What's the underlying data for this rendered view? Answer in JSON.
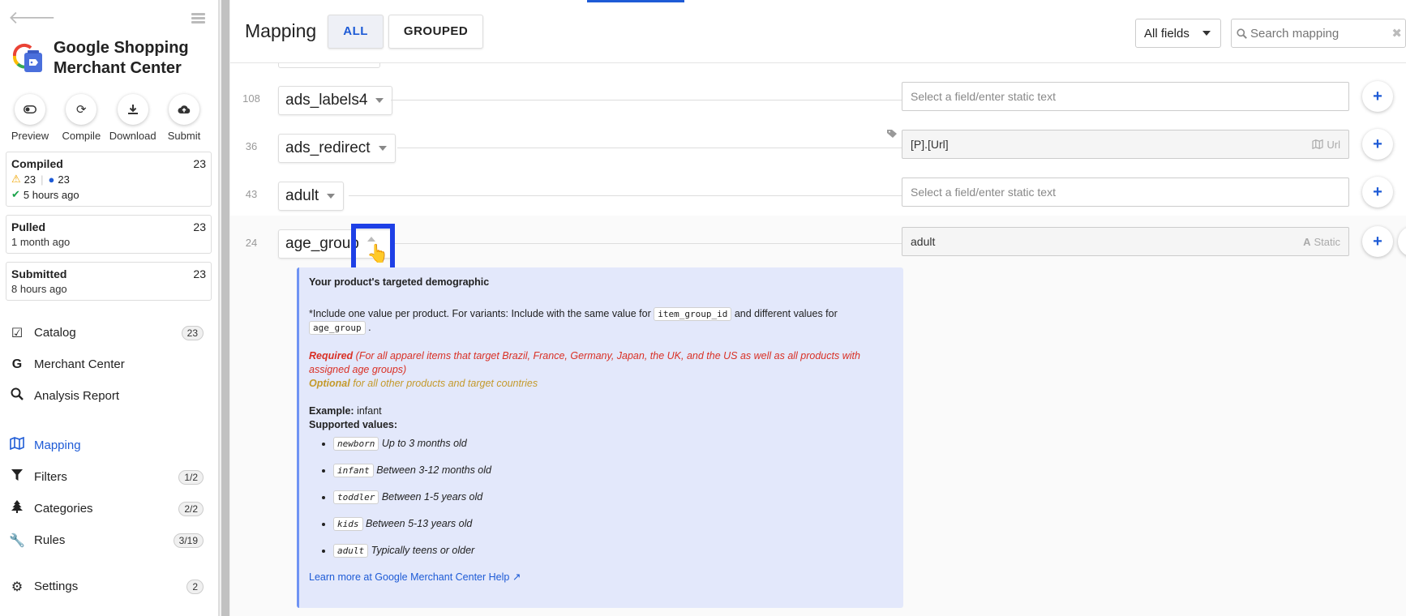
{
  "sidebar": {
    "brand_line1": "Google Shopping",
    "brand_line2": "Merchant Center",
    "actions": [
      {
        "label": "Preview",
        "icon": "toggle-icon"
      },
      {
        "label": "Compile",
        "icon": "refresh-icon"
      },
      {
        "label": "Download",
        "icon": "download-icon"
      },
      {
        "label": "Submit",
        "icon": "cloud-upload-icon"
      }
    ],
    "compiled": {
      "title": "Compiled",
      "count": "23",
      "warnings": "23",
      "infos": "23",
      "time": "5 hours ago"
    },
    "pulled": {
      "title": "Pulled",
      "count": "23",
      "time": "1 month ago"
    },
    "submitted": {
      "title": "Submitted",
      "count": "23",
      "time": "8 hours ago"
    },
    "nav": [
      {
        "label": "Catalog",
        "badge": "23"
      },
      {
        "label": "Merchant Center",
        "badge": ""
      },
      {
        "label": "Analysis Report",
        "badge": ""
      },
      {
        "label": "Mapping",
        "badge": ""
      },
      {
        "label": "Filters",
        "badge": "1/2"
      },
      {
        "label": "Categories",
        "badge": "2/2"
      },
      {
        "label": "Rules",
        "badge": "3/19"
      },
      {
        "label": "Settings",
        "badge": "2"
      }
    ]
  },
  "header": {
    "title": "Mapping",
    "tab_all": "ALL",
    "tab_grouped": "GROUPED",
    "fields_select": "All fields",
    "search_placeholder": "Search mapping"
  },
  "rows": [
    {
      "num": "108",
      "field": "ads_labels4",
      "value": "",
      "placeholder": "Select a field/enter static text",
      "tag": ""
    },
    {
      "num": "36",
      "field": "ads_redirect",
      "value": "[P].[Url]",
      "placeholder": "",
      "tag": "Url"
    },
    {
      "num": "43",
      "field": "adult",
      "value": "",
      "placeholder": "Select a field/enter static text",
      "tag": ""
    },
    {
      "num": "24",
      "field": "age_group",
      "value": "adult",
      "placeholder": "",
      "tag": "Static"
    }
  ],
  "help": {
    "title": "Your product's targeted demographic",
    "include_a": "*Include one value per product. For variants: Include with the same value for",
    "include_code1": "item_group_id",
    "include_b": "and different values for",
    "include_code2": "age_group",
    "include_c": ".",
    "required_label": "Required",
    "required_text": "(For all apparel items that target Brazil, France, Germany, Japan, the UK, and the US as well as all products with assigned age groups)",
    "optional_label": "Optional",
    "optional_text": "for all other products and target countries",
    "example_label": "Example:",
    "example_value": "infant",
    "supported_label": "Supported values:",
    "values": [
      {
        "code": "newborn",
        "desc": "Up to 3 months old"
      },
      {
        "code": "infant",
        "desc": "Between 3-12 months old"
      },
      {
        "code": "toddler",
        "desc": "Between 1-5 years old"
      },
      {
        "code": "kids",
        "desc": "Between 5-13 years old"
      },
      {
        "code": "adult",
        "desc": "Typically teens or older"
      }
    ],
    "link": "Learn more at Google Merchant Center Help"
  }
}
